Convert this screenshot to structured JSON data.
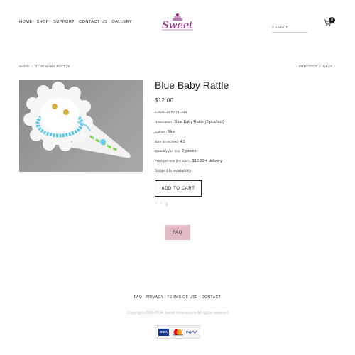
{
  "header": {
    "nav": [
      "HOME",
      "SHOP",
      "SUPPORT",
      "CONTACT US",
      "GALLERY"
    ],
    "logo_text": "Sweet",
    "search_placeholder": "SEARCH",
    "cart_count": "0"
  },
  "breadcrumb": {
    "items": [
      "SHOP",
      "BLUE BABY RATTLE"
    ],
    "separator": "›"
  },
  "pagination": {
    "previous": "‹ PREVIOUS",
    "separator": "/",
    "next": "NEXT ›"
  },
  "product": {
    "title": "Blue Baby Rattle",
    "price": "$12.00",
    "code": "CODE: SFRATTLEBL",
    "description_label": "Description : ",
    "description_value": "Blue Baby Rattle (2 pcs/box)",
    "colour_label": "Colour : ",
    "colour_value": "Blue",
    "size_label": "Size (in inches): ",
    "size_value": "4.5",
    "quantity_label": "Quantity per box: ",
    "quantity_value": "2 pieces",
    "price_box_label": "Price per box (inc GST): ",
    "price_box_value": "$12.30 + delivery",
    "availability": "Subject to availability",
    "add_to_cart": "ADD TO CART"
  },
  "share_icons": [
    "f",
    "t",
    "p"
  ],
  "faq_button": "FAQ",
  "footer": {
    "links": [
      "FAQ",
      "PRIVACY",
      "TERMS OF USE",
      "CONTACT"
    ],
    "copyright": "Copyright 2000-2014 Sweet Inspirations All rights reserved",
    "payments": [
      "VISA",
      "mastercard",
      "PayPal"
    ]
  },
  "colors": {
    "logo_purple": "#a3208f",
    "faq_pink": "#e3bcc3",
    "image_bg": "#9a9a9a"
  }
}
